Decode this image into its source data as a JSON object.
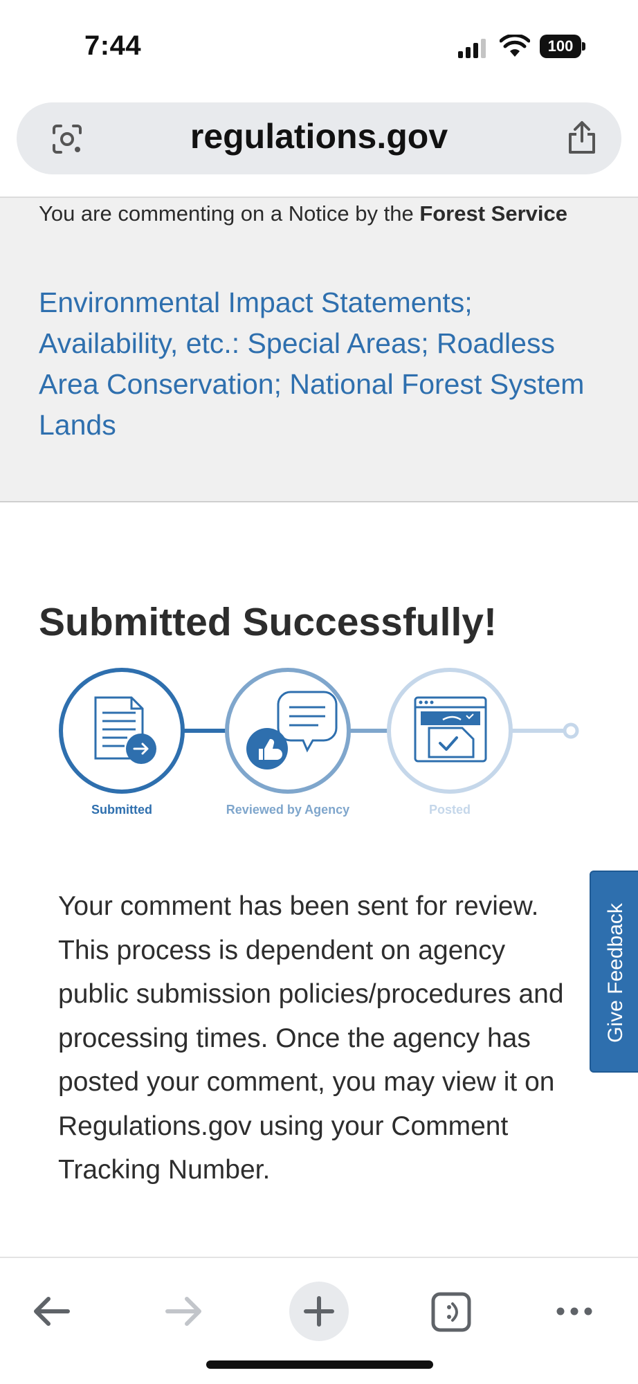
{
  "status_bar": {
    "time": "7:44",
    "battery_level": "100",
    "icons": [
      "cellular-signal-icon",
      "wifi-icon",
      "battery-icon"
    ]
  },
  "browser": {
    "url": "regulations.gov",
    "icons": [
      "lens-icon",
      "share-icon"
    ]
  },
  "notice": {
    "intro": "You are commenting on a Notice by the",
    "agency": "Forest Service",
    "title": "Environmental Impact Statements; Availability, etc.: Special Areas; Roadless Area Conservation; National Forest System Lands"
  },
  "main": {
    "success_title": "Submitted Successfully!",
    "steps": [
      {
        "label": "Submitted",
        "icon": "document-arrow-icon",
        "state": "complete"
      },
      {
        "label": "Reviewed by Agency",
        "icon": "comment-thumbs-up-icon",
        "state": "pending"
      },
      {
        "label": "Posted",
        "icon": "browser-window-check-icon",
        "state": "pending"
      }
    ],
    "body": "Your comment has been sent for review. This process is dependent on agency public submission policies/procedures and processing times. Once the agency has posted your comment, you may view it on Regulations.gov using your Comment Tracking Number."
  },
  "feedback": {
    "label": "Give Feedback"
  },
  "toolbar": {
    "icons": [
      "back-arrow-icon",
      "forward-arrow-icon",
      "plus-icon",
      "tabs-icon",
      "more-icon"
    ]
  },
  "colors": {
    "link_blue": "#2e6fae",
    "step_complete": "#2e6fae",
    "step_mid": "#7fa6cc",
    "step_light": "#c5d7ea"
  }
}
